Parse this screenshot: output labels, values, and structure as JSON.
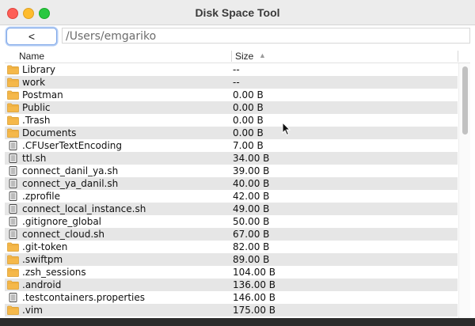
{
  "window": {
    "title": "Disk Space Tool"
  },
  "toolbar": {
    "back_label": "<",
    "path": "/Users/emgariko"
  },
  "table": {
    "columns": [
      "Name",
      "Size"
    ],
    "sort": {
      "column": "Size",
      "direction": "ascending"
    },
    "rows": [
      {
        "name": "Library",
        "size": "--",
        "icon": "folder-icon"
      },
      {
        "name": "work",
        "size": "--",
        "icon": "folder-icon"
      },
      {
        "name": "Postman",
        "size": "0.00 B",
        "icon": "folder-icon"
      },
      {
        "name": "Public",
        "size": "0.00 B",
        "icon": "folder-icon"
      },
      {
        "name": ".Trash",
        "size": "0.00 B",
        "icon": "folder-icon"
      },
      {
        "name": "Documents",
        "size": "0.00 B",
        "icon": "folder-icon"
      },
      {
        "name": ".CFUserTextEncoding",
        "size": "7.00 B",
        "icon": "file-icon"
      },
      {
        "name": "ttl.sh",
        "size": "34.00 B",
        "icon": "file-icon"
      },
      {
        "name": "connect_danil_ya.sh",
        "size": "39.00 B",
        "icon": "file-icon"
      },
      {
        "name": "connect_ya_danil.sh",
        "size": "40.00 B",
        "icon": "file-icon"
      },
      {
        "name": ".zprofile",
        "size": "42.00 B",
        "icon": "file-icon"
      },
      {
        "name": "connect_local_instance.sh",
        "size": "49.00 B",
        "icon": "file-icon"
      },
      {
        "name": ".gitignore_global",
        "size": "50.00 B",
        "icon": "file-icon"
      },
      {
        "name": "connect_cloud.sh",
        "size": "67.00 B",
        "icon": "file-icon"
      },
      {
        "name": ".git-token",
        "size": "82.00 B",
        "icon": "folder-icon"
      },
      {
        "name": ".swiftpm",
        "size": "89.00 B",
        "icon": "folder-icon"
      },
      {
        "name": ".zsh_sessions",
        "size": "104.00 B",
        "icon": "folder-icon"
      },
      {
        "name": ".android",
        "size": "136.00 B",
        "icon": "folder-icon"
      },
      {
        "name": ".testcontainers.properties",
        "size": "146.00 B",
        "icon": "file-icon"
      },
      {
        "name": ".vim",
        "size": "175.00 B",
        "icon": "folder-icon"
      }
    ]
  },
  "colors": {
    "folder": "#f5b84a",
    "row_alt": "#e6e6e6",
    "focus_ring": "#7ea7e8"
  }
}
